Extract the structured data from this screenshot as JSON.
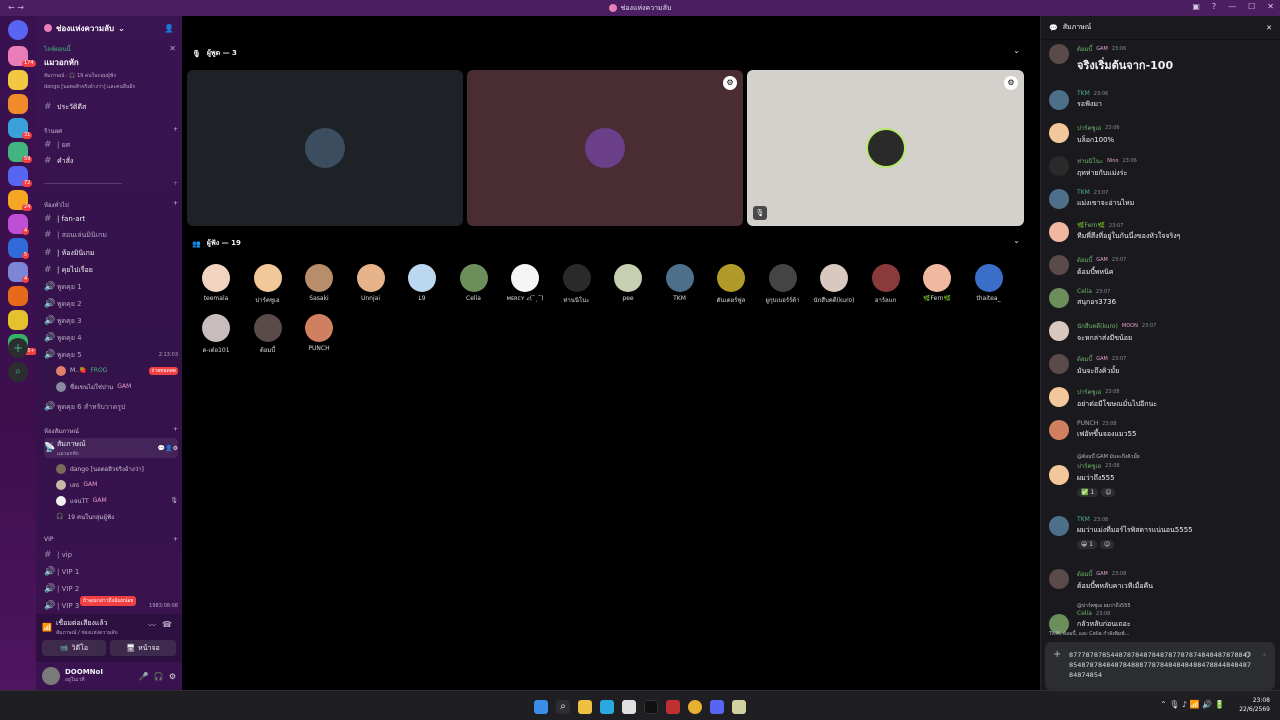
{
  "window": {
    "title": "ช่องแห่งความลับ"
  },
  "guilds": [
    {
      "color": "#e87db8",
      "badge": "174"
    },
    {
      "color": "#f1c83f",
      "badge": ""
    },
    {
      "color": "#f08a2b",
      "badge": ""
    },
    {
      "color": "#3aa1d8",
      "badge": "31"
    },
    {
      "color": "#43b581",
      "badge": "59"
    },
    {
      "color": "#5865f2",
      "badge": "72"
    },
    {
      "color": "#f5a623",
      "badge": "24"
    },
    {
      "color": "#c04fd8",
      "badge": "4"
    },
    {
      "color": "#2f6ad8",
      "badge": "5"
    },
    {
      "color": "#7b86d6",
      "badge": "4"
    },
    {
      "color": "#e66a1a",
      "badge": ""
    },
    {
      "color": "#e5c12e",
      "badge": ""
    },
    {
      "color": "#35b26a",
      "badge": "96+"
    }
  ],
  "server": {
    "name": "ช่องแห่งความลับ"
  },
  "event": {
    "tag": "ไลฟ์ตอนนี้",
    "title": "แมวอกหัก",
    "line1": "สัมภาษณ์ · 🎧 19 คนในกลุ่มผู้ฟัง",
    "line2": "dango [นอตอสิวจริงอ้างว่า] และคนอื่นอีก"
  },
  "channels": {
    "history": "ประวัติดีส",
    "cat_rank": "ร้านยศ",
    "rank": "| ยศ",
    "command": "คำสั่ง",
    "divider": "—————————————",
    "cat_general": "ห้องทั่วไป",
    "fanart": "| fan-art",
    "rule": "| สอนเล่นมินิเกม",
    "minigame": "| ห้องมินิเกม",
    "chat": "| คุยไปเรื่อย",
    "talk1": "พูดคุย 1",
    "talk2": "พูดคุย 2",
    "talk3": "พูดคุย 3",
    "talk4": "พูดคุย 4",
    "talk5": "พูดคุย 5",
    "talk5_time": "2:13:03",
    "talk5_u1": "M..🍓",
    "talk5_u1_tag": "FROG",
    "talk5_u1_live": "ถ่ายทอดสด",
    "talk5_u2": "ชื่อเขนไม่ใช่ปาน",
    "talk5_u2_tag": "GAM",
    "talk6": "พูดคุย 6 สำหรับวาดรูป",
    "cat_stage": "ห้องสัมภาษณ์",
    "stage": "สัมภาษณ์",
    "stage_sub": "แมวอกหัก",
    "stage_u1": "dango [นอตอสิวจริงอ้างว่า]",
    "stage_u2": "เสธ",
    "stage_u2_tag": "GAM",
    "stage_u3": "แจนTT",
    "stage_u3_tag": "GAM",
    "stage_aud": "19 คนในกลุ่มผู้ฟัง",
    "cat_vip": "VIP",
    "vip": "| vip",
    "vip1": "| VIP 1",
    "vip2": "| VIP 2",
    "vip3": "| VIP 3",
    "vip3_time": "1983:08:08",
    "tooltip": "ถ้าคุณกล่าวถึงฉันหน่อย"
  },
  "voice": {
    "status": "เชื่อมต่อเสียงแล้ว",
    "channel": "สัมภาษณ์ / ช่องแห่งความลับ",
    "video": "วิดีโอ",
    "screen": "หน้าจอ"
  },
  "user": {
    "name": "DOOMNoI",
    "status": "อยู่ในเวที"
  },
  "stage": {
    "speakers_label": "ผู้พูด — 3",
    "speakers": [
      {
        "bg": "#1e2226",
        "av": "#3b4d5e"
      },
      {
        "bg": "#4a2d33",
        "av": "#6b3f8a"
      },
      {
        "bg": "#d4d0cc",
        "av": "#2a2a2a"
      }
    ],
    "audience_label": "ผู้ฟัง — 19",
    "audience": [
      {
        "name": "teemala",
        "c": "#f0d4c0"
      },
      {
        "name": "ปาร์คซูเอ",
        "c": "#f2c79a"
      },
      {
        "name": "Sasaki",
        "c": "#b88d6a"
      },
      {
        "name": "Unnjai",
        "c": "#e6b38a"
      },
      {
        "name": "L9",
        "c": "#bcd8f0"
      },
      {
        "name": "Celia",
        "c": "#6b8e5a"
      },
      {
        "name": "ᴍᴇʀᴄʏ ረ(˘¸˘)",
        "c": "#f5f5f5"
      },
      {
        "name": "ท่านนิโนะ",
        "c": "#2a2a2a"
      },
      {
        "name": "pee",
        "c": "#c6cfb0"
      },
      {
        "name": "TKM",
        "c": "#4d6f8a"
      },
      {
        "name": "ดันเดอร์ฟูล",
        "c": "#b09a2a"
      },
      {
        "name": "ยูกุบเบอร์ร์ด้า",
        "c": "#444444"
      },
      {
        "name": "นักสืบคดี(kuro)",
        "c": "#d8c8c0"
      },
      {
        "name": "ฮาร์ลแก",
        "c": "#8a3a3a"
      },
      {
        "name": "🌿Fern🌿",
        "c": "#f0b8a0"
      },
      {
        "name": "thaitea_",
        "c": "#3a6ec8"
      },
      {
        "name": "ด-เต๋อ101",
        "c": "#c8bcbc"
      },
      {
        "name": "ต้อมบี้",
        "c": "#5a4a4a"
      },
      {
        "name": "PUNCH",
        "c": "#d08060"
      }
    ]
  },
  "chat": {
    "title": "สัมภาษณ์",
    "messages": [
      {
        "user": "ต้อมบี้",
        "tag": "GAM",
        "time": "23:06",
        "text": "จริงเริ่มต้นจาก-100",
        "color": "#6fb36a",
        "av": "#5a4a4a"
      },
      {
        "user": "TKM",
        "tag": "",
        "time": "23:06",
        "text": "รอฟังมา",
        "color": "#4fae8a",
        "av": "#4d6f8a"
      },
      {
        "user": "ปาร์คซูเอ",
        "tag": "",
        "time": "23:06",
        "text": "บล็อก100%",
        "color": "#6fb36a",
        "av": "#f2c79a"
      },
      {
        "user": "ท่านนิโนะ",
        "tag": "Nino",
        "time": "23:06",
        "text": "ฤทห่ายกับแม่งร่ะ",
        "color": "#6fb36a",
        "av": "#2a2a2a"
      },
      {
        "user": "TKM",
        "tag": "",
        "time": "23:07",
        "text": "แม่งเขาจะอ่านไหม",
        "color": "#4fae8a",
        "av": "#4d6f8a"
      },
      {
        "user": "🌿Fern🌿",
        "tag": "",
        "time": "23:07",
        "text": "ทีมพี่สึงที่อยู่ในกันนึ่งของหัวใจจริงๆ",
        "color": "#6fb36a",
        "av": "#f0b8a0"
      },
      {
        "user": "ต้อมบี้",
        "tag": "GAM",
        "time": "23:07",
        "text": "ต้อมบี้พหนิค",
        "color": "#6fb36a",
        "av": "#5a4a4a"
      },
      {
        "user": "Celia",
        "tag": "",
        "time": "23:07",
        "text": "สนุกอร3736",
        "color": "#6fb36a",
        "av": "#6b8e5a"
      },
      {
        "user": "นักสืบคดี(kuro)",
        "tag": "MOON",
        "time": "23:07",
        "text": "จะหกล่าส่งมีขน้อย",
        "color": "#6fb36a",
        "av": "#d8c8c0"
      },
      {
        "user": "ต้อมบี้",
        "tag": "GAM",
        "time": "23:07",
        "text": "มันจะถึงคิวมั้ย",
        "color": "#6fb36a",
        "av": "#5a4a4a"
      },
      {
        "user": "ปาร์คซูเอ",
        "tag": "",
        "time": "23:08",
        "text": "อย่าต่อมีโฆษณมั่นไปอีกนะ",
        "color": "#6fb36a",
        "av": "#f2c79a"
      },
      {
        "user": "PUNCH",
        "tag": "",
        "time": "23:08",
        "text": "เฟอัทขึ้นจองแมว55",
        "color": "#b0a0a0",
        "av": "#d08060"
      },
      {
        "user": "ปาร์คซูเอ",
        "tag": "",
        "time": "23:08",
        "text": "ผมว่าถึง555",
        "color": "#6fb36a",
        "av": "#f2c79a",
        "reply": "@ต้อมบี้ GAM มันจะถึงคิวมั้ย",
        "react": "✅ 1"
      },
      {
        "user": "TKM",
        "tag": "",
        "time": "23:08",
        "text": "ผมว่าแม่งที่มอร์ไรพิสดารแน่นอน5555",
        "color": "#4fae8a",
        "av": "#4d6f8a",
        "react": "😀 1"
      },
      {
        "user": "ต้อมบี้",
        "tag": "GAM",
        "time": "23:08",
        "text": "ต้อมบี้พหลับคาเวทีเมื่อคืน",
        "color": "#6fb36a",
        "av": "#5a4a4a"
      },
      {
        "user": "Celia",
        "tag": "",
        "time": "23:08",
        "text": "กลัวหลับก่อนเถอะ",
        "color": "#6fb36a",
        "av": "#6b8e5a",
        "reply": "@ปาร์คซูเอ ผมว่าถึง555"
      }
    ],
    "typing": "TKM, ต้อมบี้, และ Celia กำลังพิมพ์...",
    "composer": "877787878544878784878487877878748484878788478548787848487848887787848484848847884484848784874854"
  },
  "taskbar": {
    "time": "23:08",
    "date": "22/6/2569"
  }
}
